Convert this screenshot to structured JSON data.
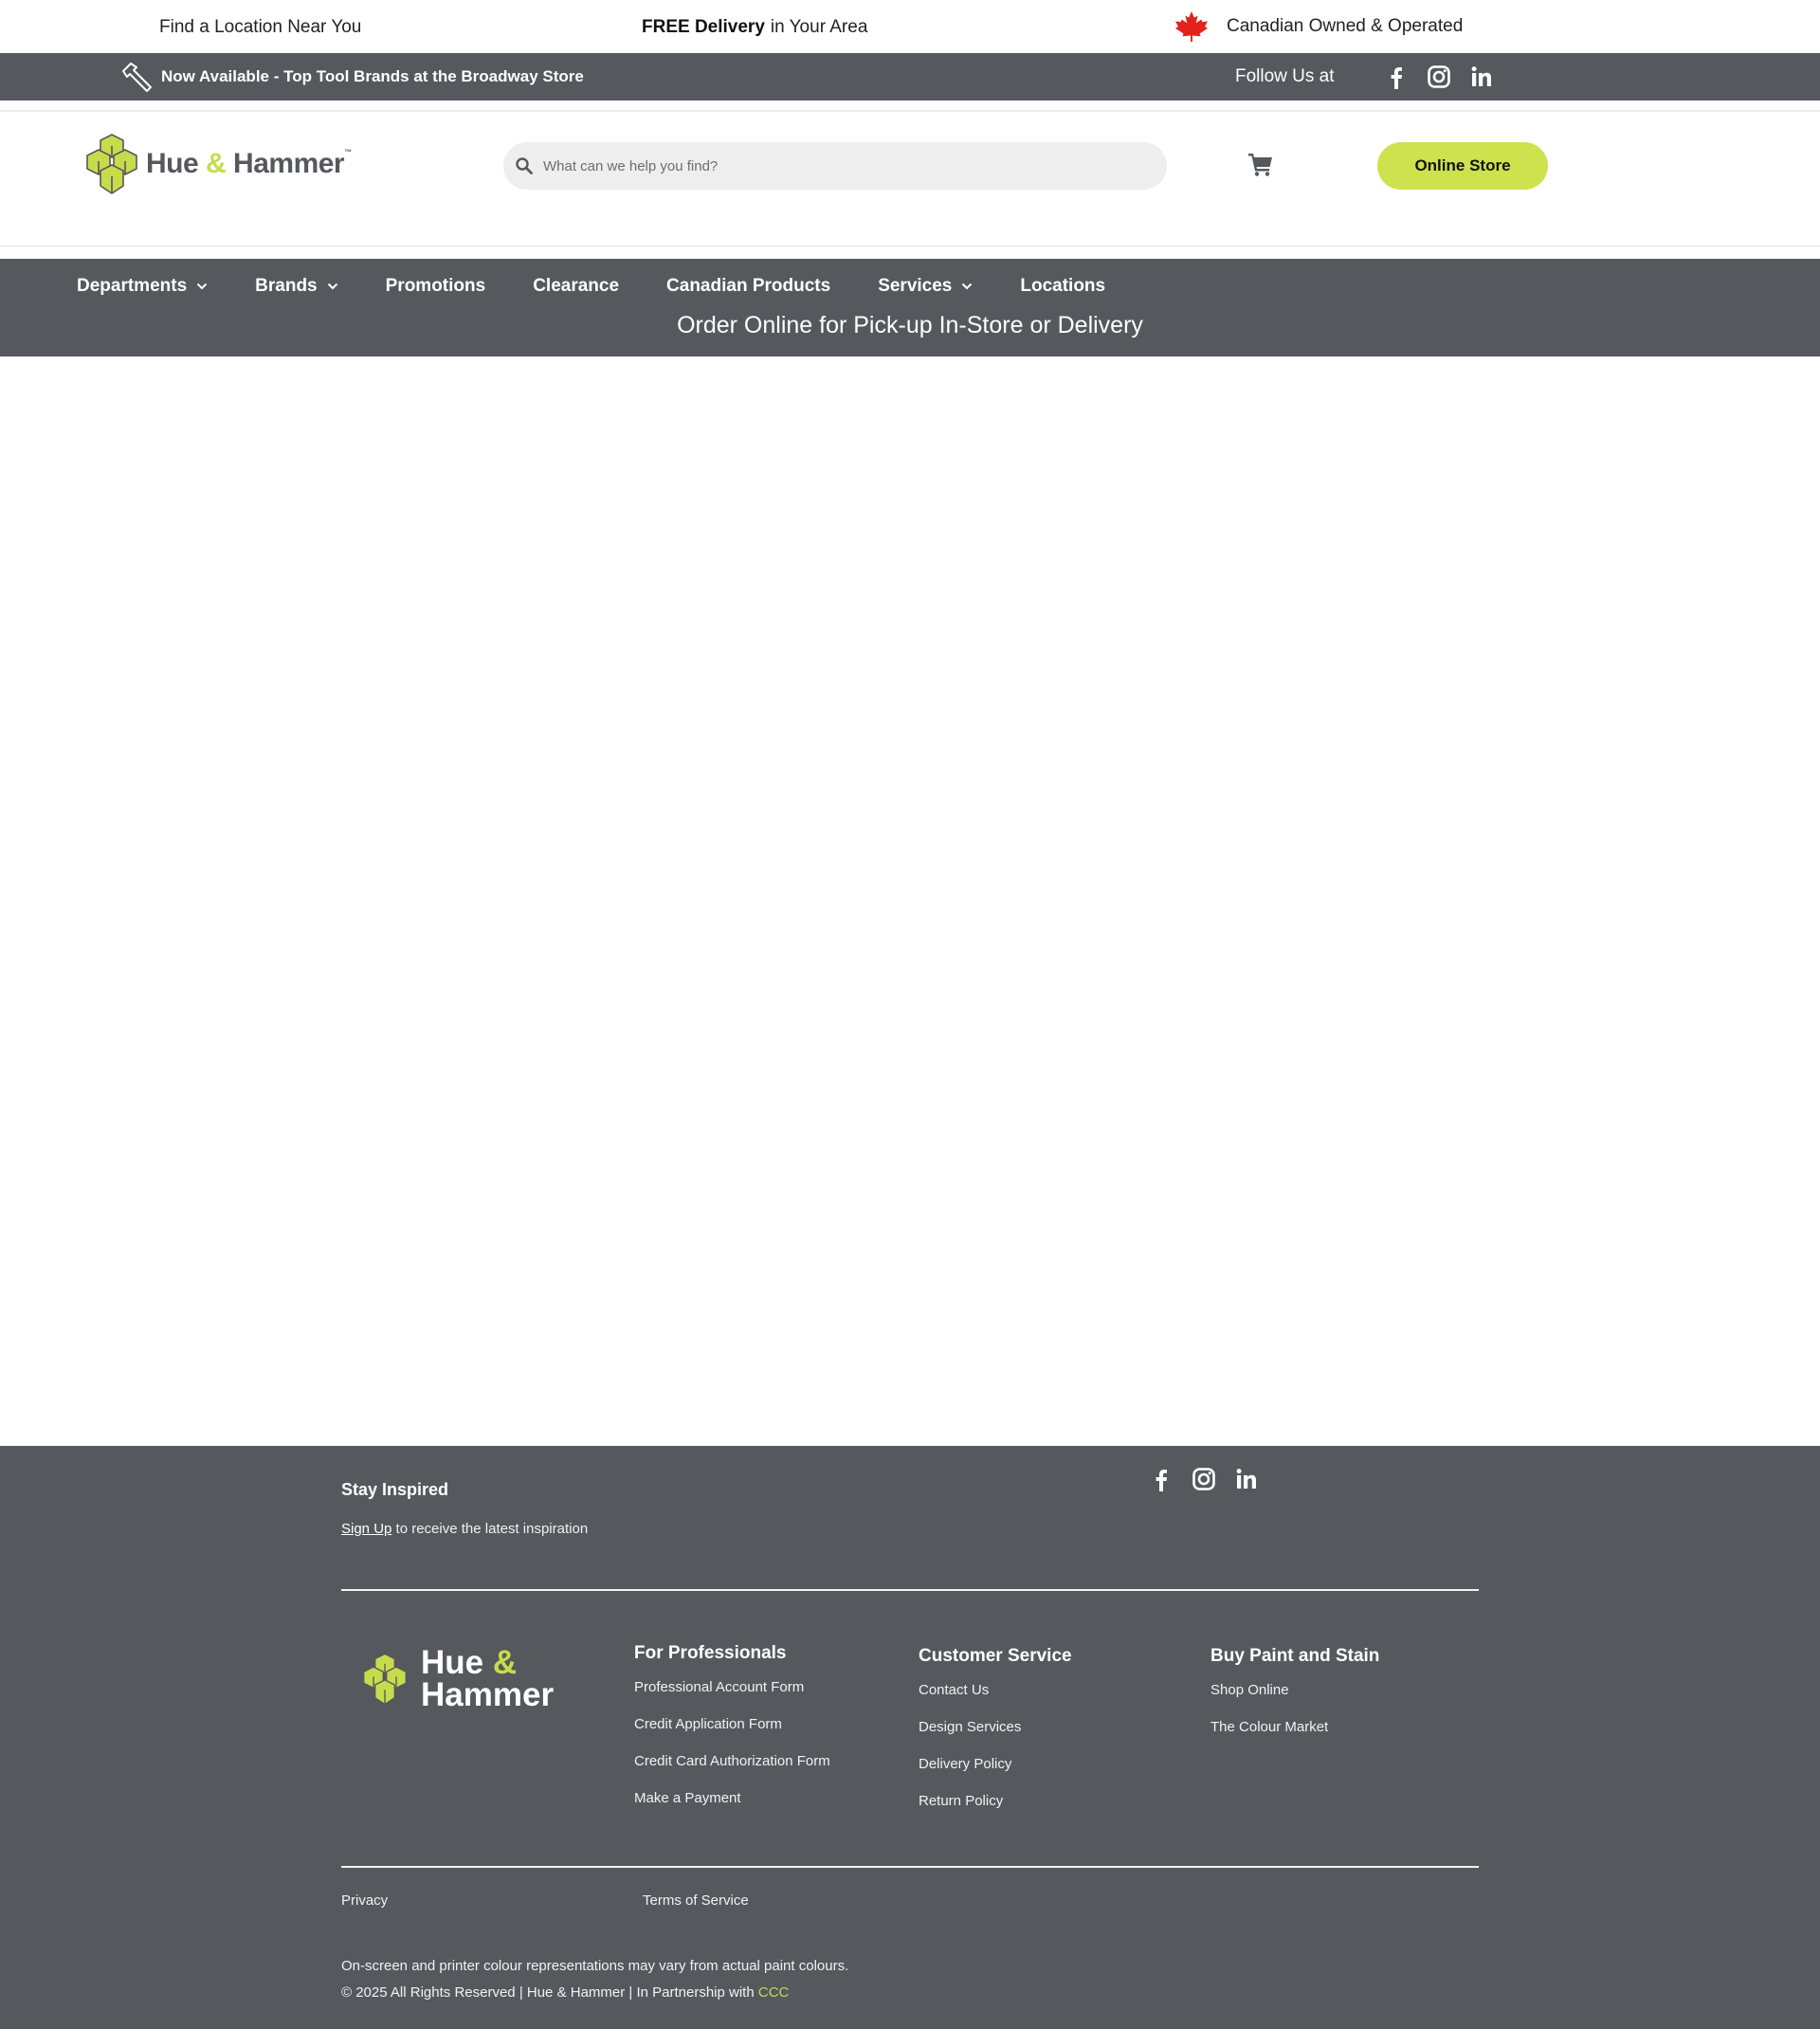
{
  "topbar": {
    "location": "Find a Location Near You",
    "delivery_bold": "FREE Delivery",
    "delivery_rest": "in Your Area",
    "canada": "Canadian Owned & Operated"
  },
  "announcement": {
    "message": "Now Available - Top Tool Brands at the Broadway Store",
    "follow": "Follow Us at"
  },
  "header": {
    "logo": {
      "word1": "Hue",
      "amp": "&",
      "word2": "Hammer",
      "tm": "™"
    },
    "search_placeholder": "What can we help you find?",
    "online_store": "Online Store"
  },
  "nav": {
    "items": [
      {
        "label": "Departments",
        "dropdown": true
      },
      {
        "label": "Brands",
        "dropdown": true
      },
      {
        "label": "Promotions",
        "dropdown": false
      },
      {
        "label": "Clearance",
        "dropdown": false
      },
      {
        "label": "Canadian Products",
        "dropdown": false
      },
      {
        "label": "Services",
        "dropdown": true
      },
      {
        "label": "Locations",
        "dropdown": false
      }
    ],
    "tagline": "Order Online for Pick-up In-Store or Delivery"
  },
  "footer": {
    "stay_inspired": "Stay Inspired",
    "signup_link": "Sign Up",
    "signup_rest": "to receive the latest inspiration",
    "logo": {
      "word1": "Hue",
      "amp": "&",
      "word2": "Hammer"
    },
    "columns": [
      {
        "title": "For Professionals",
        "links": [
          "Professional Account Form",
          "Credit Application Form",
          "Credit Card Authorization Form",
          "Make a Payment"
        ]
      },
      {
        "title": "Customer Service",
        "links": [
          "Contact Us",
          "Design Services",
          "Delivery Policy",
          "Return Policy"
        ]
      },
      {
        "title": "Buy Paint and Stain",
        "links": [
          "Shop Online",
          "The Colour Market"
        ]
      }
    ],
    "privacy": "Privacy",
    "terms": "Terms of Service",
    "disclaimer": "On-screen and printer colour representations may vary from actual paint colours.",
    "copyright_prefix": "© 2025 All Rights Reserved | Hue & Hammer | In Partnership with",
    "copyright_partner": "CCC"
  },
  "colors": {
    "accent": "#cde24d",
    "dark_gray": "#55585d",
    "maple_red": "#e3231b"
  },
  "icons": [
    "maple-leaf-icon",
    "hammer-icon",
    "facebook-icon",
    "instagram-icon",
    "linkedin-icon",
    "search-icon",
    "cart-icon",
    "chevron-down-icon",
    "logo-mark"
  ]
}
